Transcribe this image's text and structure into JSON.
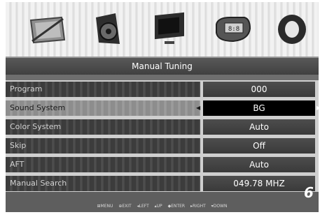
{
  "icons": [
    {
      "name": "picture-icon"
    },
    {
      "name": "sound-icon"
    },
    {
      "name": "tv-icon"
    },
    {
      "name": "time-icon"
    },
    {
      "name": "setup-icon"
    }
  ],
  "menu_title": "Manual Tuning",
  "rows": [
    {
      "label": "Program",
      "value": "000"
    },
    {
      "label": "Sound System",
      "value": "BG"
    },
    {
      "label": "Color System",
      "value": "Auto"
    },
    {
      "label": "Skip",
      "value": "Off"
    },
    {
      "label": "AFT",
      "value": "Auto"
    },
    {
      "label": "Manual Search",
      "value": "049.78 MHZ"
    }
  ],
  "selected_row": "Sound System",
  "key_hints": "⊞MENU ⊕EXIT ◂LEFT ▴UP ◆ENTER ▸RIGHT ▾DOWN",
  "page_number": "6",
  "colors": {
    "background": "#cfcfcf",
    "title_bar": "#4a4a4a",
    "selected_value": "#000000",
    "text": "#ffffff"
  }
}
